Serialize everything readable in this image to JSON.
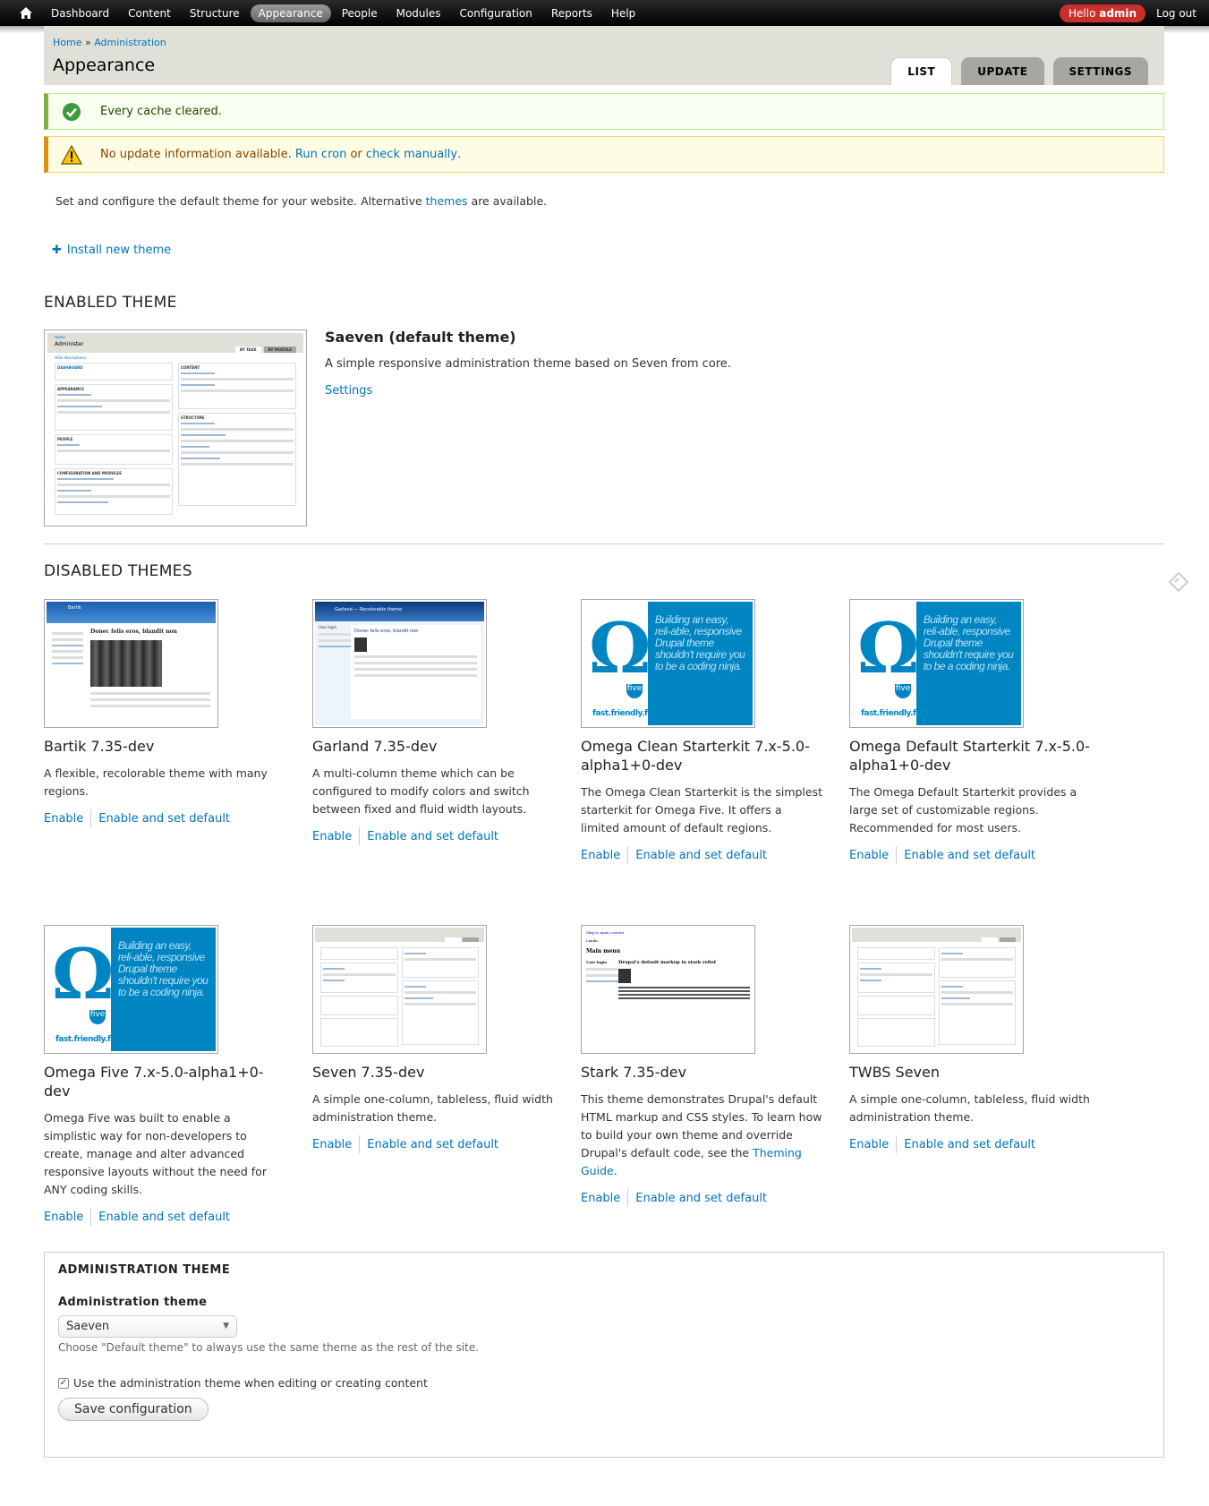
{
  "toolbar": {
    "items": [
      "Dashboard",
      "Content",
      "Structure",
      "Appearance",
      "People",
      "Modules",
      "Configuration",
      "Reports",
      "Help"
    ],
    "active": "Appearance",
    "hello": "Hello ",
    "user": "admin",
    "logout": "Log out"
  },
  "header": {
    "breadcrumb": [
      "Home",
      "Administration"
    ],
    "breadcrumb_sep": " » ",
    "title": "Appearance",
    "tabs": [
      "LIST",
      "UPDATE",
      "SETTINGS"
    ]
  },
  "messages": {
    "status": "Every cache cleared.",
    "warning_prefix": "No update information available. ",
    "warning_link1": "Run cron",
    "warning_mid": " or ",
    "warning_link2": "check manually",
    "warning_suffix": "."
  },
  "intro": {
    "prefix": "Set and configure the default theme for your website. Alternative ",
    "link": "themes",
    "suffix": " are available."
  },
  "install_link": "Install new theme",
  "enabled": {
    "heading": "ENABLED THEME",
    "name": "Saeven (default theme)",
    "desc": "A simple responsive administration theme based on Seven from core.",
    "settings": "Settings",
    "shot": {
      "breadcrumb": "Home",
      "title": "Administer",
      "tab1": "BY TASK",
      "tab2": "BY MODULE",
      "hide": "Hide descriptions",
      "left": [
        "DASHBOARD",
        "APPEARANCE",
        "PEOPLE",
        "CONFIGURATION AND MODULES"
      ],
      "right": [
        "CONTENT",
        "STRUCTURE"
      ]
    }
  },
  "disabled": {
    "heading": "DISABLED THEMES",
    "enable": "Enable",
    "enable_default": "Enable and set default",
    "omega_text": "Building an easy, reli-able, responsive Drupal theme shouldn't require you to be a coding ninja.",
    "omega_tagline": "fast.friendly.flexible.",
    "omega_five": "five",
    "themes": [
      {
        "name": "Bartik 7.35-dev",
        "desc": "A flexible, recolorable theme with many regions."
      },
      {
        "name": "Garland 7.35-dev",
        "desc": "A multi-column theme which can be configured to modify colors and switch between fixed and fluid width layouts."
      },
      {
        "name": "Omega Clean Starterkit 7.x-5.0-alpha1+0-dev",
        "desc": "The Omega Clean Starterkit is the simplest starterkit for Omega Five. It offers a limited amount of default regions."
      },
      {
        "name": "Omega Default Starterkit 7.x-5.0-alpha1+0-dev",
        "desc": "The Omega Default Starterkit provides a large set of customizable regions. Recommended for most users."
      },
      {
        "name": "Omega Five 7.x-5.0-alpha1+0-dev",
        "desc": "Omega Five was built to enable a simplistic way for non-developers to create, manage and alter advanced responsive layouts without the need for ANY coding skills."
      },
      {
        "name": "Seven 7.35-dev",
        "desc": "A simple one-column, tableless, fluid width administration theme."
      },
      {
        "name": "Stark 7.35-dev",
        "desc": "This theme demonstrates Drupal's default HTML markup and CSS styles. To learn how to build your own theme and override Drupal's default code, see the ",
        "desc_link": "Theming Guide",
        "desc_suffix": "."
      },
      {
        "name": "TWBS Seven",
        "desc": "A simple one-column, tableless, fluid width administration theme."
      }
    ],
    "bartik_shot": {
      "site": "Bartik",
      "headline": "Donec felis eros, blandit non"
    },
    "garland_shot": {
      "site": "Garland — Recolorable theme",
      "headline": "Donec felis eros, blandit non",
      "login": "User login"
    },
    "stark_shot": {
      "skip": "Skip to main content",
      "site": "Landis",
      "menu": "Main menu",
      "headline": "Drupal's default markup in stark relief",
      "login": "User login"
    }
  },
  "admin_theme": {
    "legend": "ADMINISTRATION THEME",
    "label": "Administration theme",
    "selected": "Saeven",
    "help": "Choose \"Default theme\" to always use the same theme as the rest of the site.",
    "checkbox_label": "Use the administration theme when editing or creating content",
    "checked": true,
    "save": "Save configuration"
  },
  "colors": {
    "link": "#0074bd",
    "status_border": "#7cb342",
    "warning_border": "#e09010",
    "hello_bg": "#c9302c",
    "omega_blue": "#0085c3"
  }
}
